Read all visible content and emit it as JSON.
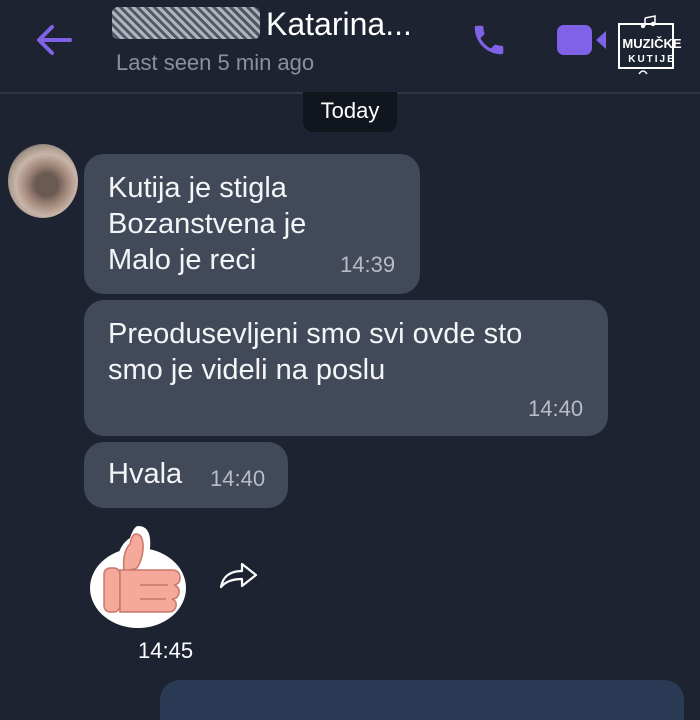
{
  "header": {
    "contact_name": "Katarina...",
    "status": "Last seen 5 min ago",
    "logo_text_top": "MUZIČKE",
    "logo_text_bottom": "KUTIJE"
  },
  "date_divider": "Today",
  "messages": [
    {
      "lines": [
        "Kutija je stigla",
        "Bozanstvena je",
        "Malo je reci"
      ],
      "time": "14:39"
    },
    {
      "lines": [
        "Preodusevljeni smo svi ovde sto",
        "smo je videli na poslu"
      ],
      "time": "14:40"
    },
    {
      "lines": [
        "Hvala"
      ],
      "time": "14:40"
    }
  ],
  "sticker": {
    "icon": "thumbs-up-sticker",
    "time": "14:45"
  },
  "colors": {
    "accent": "#7f62e8",
    "background": "#1d2330",
    "bubble": "#424a5a"
  }
}
